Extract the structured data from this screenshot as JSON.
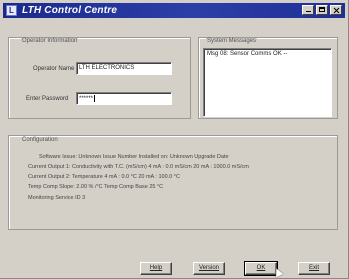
{
  "window": {
    "title": "LTH Control Centre",
    "app_icon": "lth-app-icon",
    "controls": [
      "minimize-icon",
      "maximize-icon",
      "close-icon"
    ]
  },
  "operator": {
    "group_label": "Operator Information",
    "name_label": "Operator Name",
    "name_value": "LTH ELECTRONICS",
    "password_label": "Enter Password",
    "password_value": "******"
  },
  "messages": {
    "group_label": "System Messages",
    "items": [
      "Msg 08: Sensor Comms OK  --"
    ]
  },
  "configuration": {
    "group_label": "Configuration",
    "lines": [
      "Software Issue:  Unknown Issue Number          Installed on:  Unknown Upgrade Date",
      "Current Output 1:  Conductivity with T.C. (mS/cm)   4 mA :  0.0 mS/cm    20 mA :  1000.0 mS/cm",
      "Current Output 2:  Temperature    4 mA :  0.0 °C    20 mA :  100.0 °C",
      "Temp Comp Slope:  2.00 % /°C        Temp Comp Base 25 °C",
      "Monitoring Service ID 3"
    ]
  },
  "buttons": {
    "help": "Help",
    "version": "Version",
    "ok": "OK",
    "exit": "Exit"
  }
}
